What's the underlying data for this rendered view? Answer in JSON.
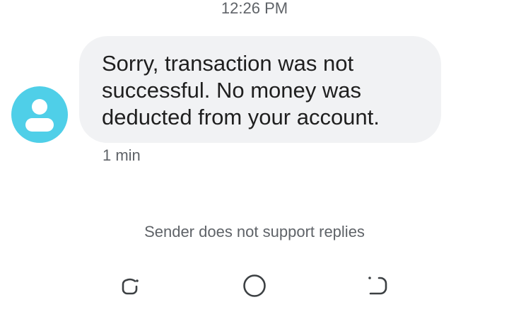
{
  "header": {
    "timestamp": "12:26 PM"
  },
  "message": {
    "text": "Sorry, transaction was not successful. No money was deducted from your account.",
    "time_ago": "1 min",
    "avatar_icon": "person-icon",
    "avatar_color": "#4fcfe8",
    "bubble_color": "#f1f2f4"
  },
  "footer": {
    "notice": "Sender does not support replies"
  },
  "navbar": {
    "recents_icon": "recents-icon",
    "home_icon": "home-icon",
    "back_icon": "back-icon"
  }
}
